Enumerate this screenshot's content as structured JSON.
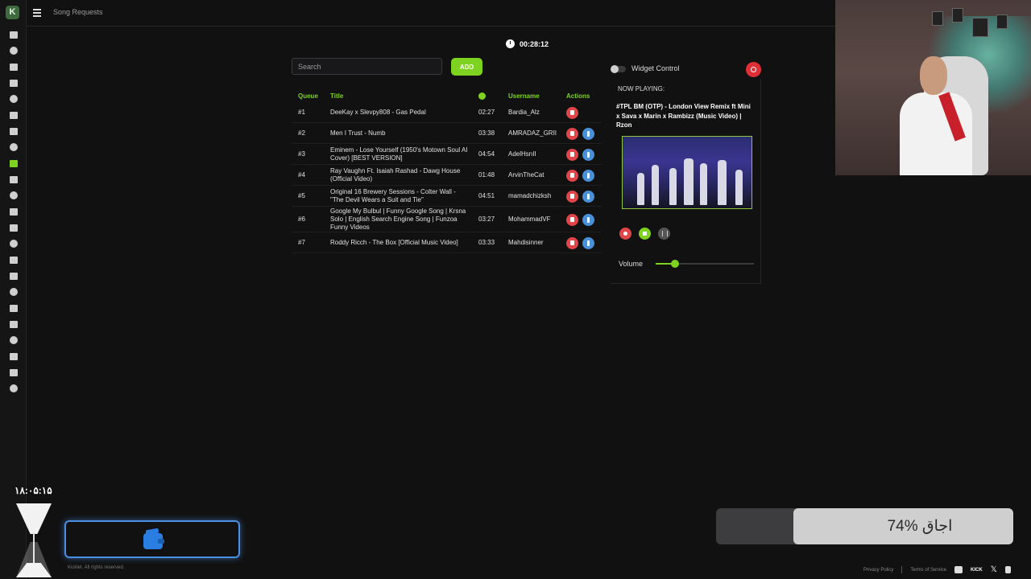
{
  "topbar": {
    "page_title": "Song Requests"
  },
  "sidebar": {
    "logo": "K",
    "icons": [
      "dashboard-icon",
      "clipboard-icon",
      "pencil-icon",
      "wrench-icon",
      "chat-icon",
      "blocked-icon",
      "shield-icon",
      "alert-icon",
      "music-icon",
      "star-icon",
      "gift-icon",
      "cart-icon",
      "link-icon",
      "chart-icon",
      "video-icon",
      "document-icon",
      "emoji-icon",
      "film-icon",
      "comment-icon",
      "monitor-icon",
      "search-icon",
      "gamepad-icon",
      "card-icon"
    ],
    "active_index": 8
  },
  "timer": {
    "value": "00:28:12"
  },
  "search": {
    "placeholder": "Search",
    "add_label": "ADD"
  },
  "table": {
    "headers": {
      "queue": "Queue",
      "title": "Title",
      "username": "Username",
      "actions": "Actions"
    },
    "rows": [
      {
        "queue": "#1",
        "title": "DeeKay x Slevpy808 - Gas Pedal",
        "time": "02:27",
        "username": "Bardia_Alz",
        "promote": false
      },
      {
        "queue": "#2",
        "title": "Men I Trust - Numb",
        "time": "03:38",
        "username": "AMRADAZ_GRII",
        "promote": true
      },
      {
        "queue": "#3",
        "title": "Eminem - Lose Yourself (1950's Motown Soul AI Cover) [BEST VERSION]",
        "time": "04:54",
        "username": "AdelHsnII",
        "promote": true
      },
      {
        "queue": "#4",
        "title": "Ray Vaughn Ft. Isaiah Rashad - Dawg House (Official Video)",
        "time": "01:48",
        "username": "ArvinTheCat",
        "promote": true
      },
      {
        "queue": "#5",
        "title": "Original 16 Brewery Sessions - Colter Wall - \"The Devil Wears a Suit and Tie\"",
        "time": "04:51",
        "username": "mamadchizksh",
        "promote": true
      },
      {
        "queue": "#6",
        "title": "Google My Bulbul | Funny Google Song | Krsna Solo | English Search Engine Song | Funzoa Funny Videos",
        "time": "03:27",
        "username": "MohammadVF",
        "promote": true
      },
      {
        "queue": "#7",
        "title": "Roddy Ricch - The Box [Official Music Video]",
        "time": "03:33",
        "username": "Mahdisinner",
        "promote": true
      }
    ]
  },
  "widget": {
    "control_label": "Widget Control",
    "enabled": false,
    "now_playing_label": "NOW PLAYING:",
    "now_playing_title": "#TPL BM (OTP) - London View Remix ft Mini x Sava x Marin x Rambizz (Music Video) | Rzon",
    "volume_label": "Volume",
    "volume_fraction": 0.2
  },
  "overlay": {
    "clock": "۱۸:۰۵:۱۵",
    "progress_text": "74% اجاق",
    "progress_fraction": 0.74
  },
  "footer": {
    "copyright": "Kicklet. All rights reserved.",
    "privacy": "Privacy Policy",
    "terms": "Terms of Service",
    "kick": "KICK",
    "x": "𝕏"
  },
  "colors": {
    "accent": "#7ed321",
    "danger": "#e0454a",
    "info": "#4a90d9",
    "background": "#111112"
  }
}
